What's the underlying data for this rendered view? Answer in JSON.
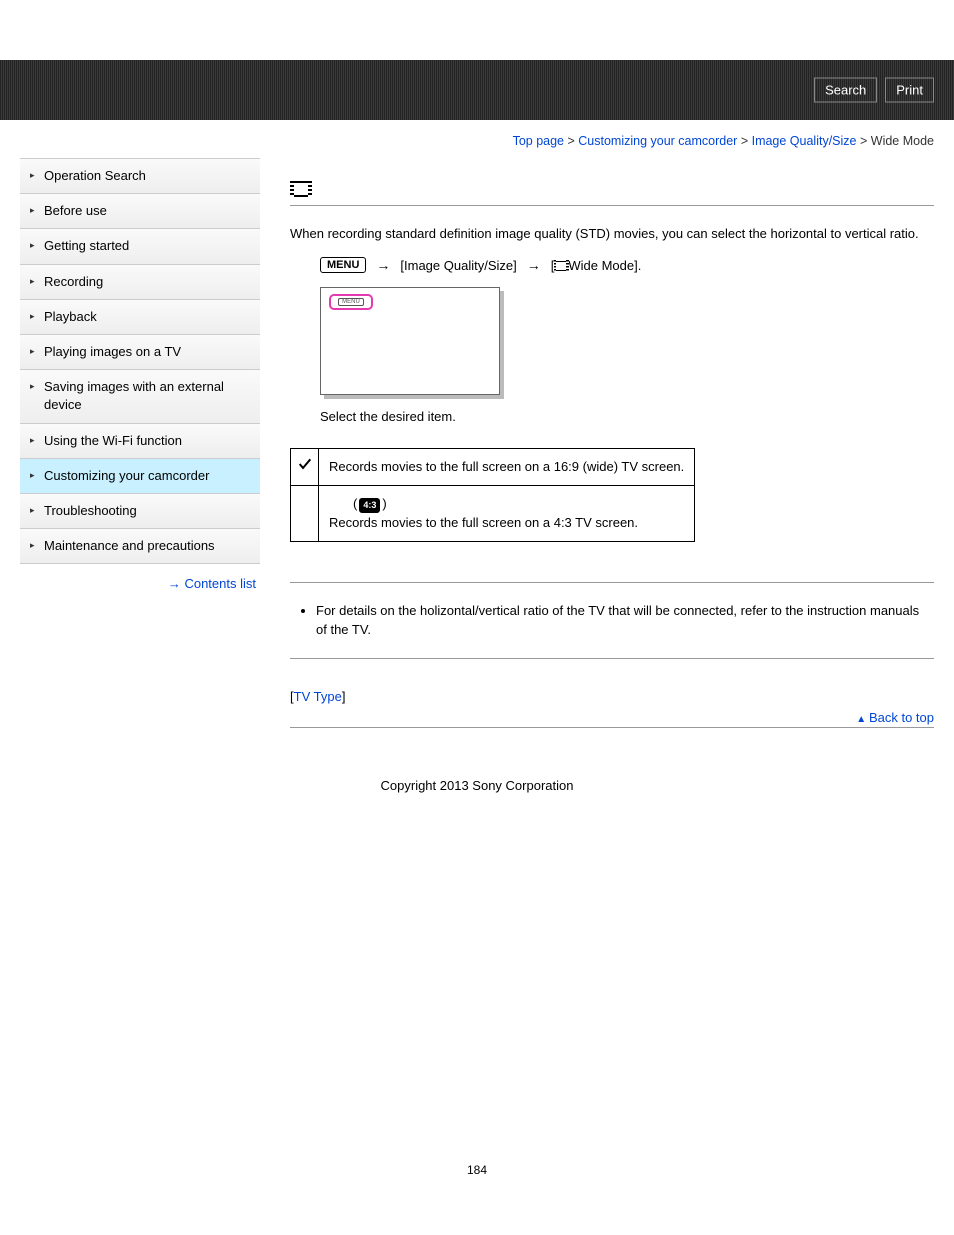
{
  "header": {
    "search_label": "Search",
    "print_label": "Print"
  },
  "breadcrumb": {
    "items": [
      "Top page",
      "Customizing your camcorder",
      "Image Quality/Size"
    ],
    "current": "Wide Mode",
    "sep": " > "
  },
  "sidebar": {
    "items": [
      {
        "label": "Operation Search"
      },
      {
        "label": "Before use"
      },
      {
        "label": "Getting started"
      },
      {
        "label": "Recording"
      },
      {
        "label": "Playback"
      },
      {
        "label": "Playing images on a TV"
      },
      {
        "label": "Saving images with an external device"
      },
      {
        "label": "Using the Wi-Fi function"
      },
      {
        "label": "Customizing your camcorder",
        "active": true
      },
      {
        "label": "Troubleshooting"
      },
      {
        "label": "Maintenance and precautions"
      }
    ],
    "contents_list": "Contents list"
  },
  "main": {
    "intro": "When recording standard definition image quality (STD) movies, you can select the horizontal to vertical ratio.",
    "menu_badge": "MENU",
    "path_seg1": "[Image Quality/Size]",
    "path_seg2_suffix": "Wide Mode].",
    "path_seg2_prefix": "[",
    "screen_menu_label": "MENU",
    "instruction": "Select the desired item.",
    "options": [
      {
        "default": true,
        "desc": "Records movies to the full screen on a 16:9 (wide) TV screen."
      },
      {
        "badge": "4:3",
        "paren_open": "(",
        "paren_close": ")",
        "desc": "Records movies to the full screen on a 4:3 TV screen."
      }
    ],
    "note": "For details on the holizontal/vertical ratio of the TV that will be connected, refer to the instruction manuals of the TV.",
    "related_open": "[",
    "related_link": "TV Type",
    "related_close": "]",
    "back_to_top": "Back to top",
    "copyright": "Copyright 2013 Sony Corporation",
    "page_number": "184"
  }
}
